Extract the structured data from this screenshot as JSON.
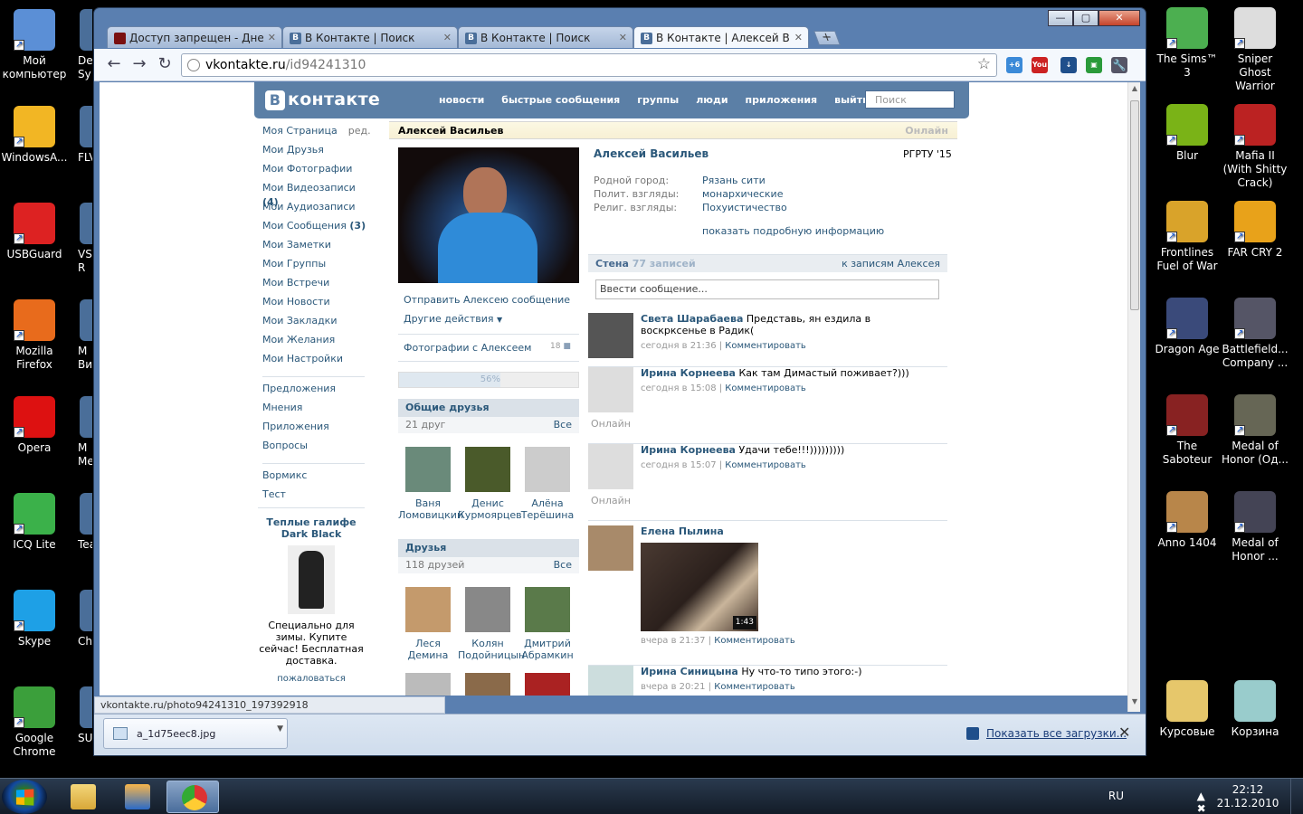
{
  "desktop": {
    "left_icons": [
      {
        "label": "Мой компьютер",
        "color": "#5b8fd6"
      },
      {
        "label": "WindowsA...",
        "color": "#f2b624"
      },
      {
        "label": "USBGuard",
        "color": "#d22"
      },
      {
        "label": "Mozilla Firefox",
        "color": "#e86b1c"
      },
      {
        "label": "Opera",
        "color": "#d11"
      },
      {
        "label": "ICQ Lite",
        "color": "#3bb14a"
      },
      {
        "label": "Skype",
        "color": "#1ea0e6"
      },
      {
        "label": "Google Chrome",
        "color": "#3b9f3b"
      }
    ],
    "partial_icons": [
      "De Sy",
      "FLV",
      "VSO R",
      "M Виде",
      "M Мед",
      "Tea",
      "Che",
      "SU"
    ],
    "right_icons": [
      {
        "label": "The Sims™ 3",
        "color": "#4caf50"
      },
      {
        "label": "Sniper Ghost Warrior",
        "color": "#ddd"
      },
      {
        "label": "Blur",
        "color": "#7ab317"
      },
      {
        "label": "Mafia II (With Shitty Crack)",
        "color": "#b22"
      },
      {
        "label": "Frontlines Fuel of War",
        "color": "#d9a32a"
      },
      {
        "label": "FAR CRY 2",
        "color": "#e8a21a"
      },
      {
        "label": "Dragon Age",
        "color": "#3a4a7a"
      },
      {
        "label": "Battlefield... Company ...",
        "color": "#556"
      },
      {
        "label": "The Saboteur",
        "color": "#822"
      },
      {
        "label": "Medal of Honor (Од...",
        "color": "#665"
      },
      {
        "label": "Anno 1404",
        "color": "#b8864a"
      },
      {
        "label": "Medal of Honor ...",
        "color": "#445"
      },
      {
        "label": "Курсовые",
        "color": "#e6c76b"
      },
      {
        "label": "Корзина",
        "color": "#9cc"
      }
    ]
  },
  "browser": {
    "tabs": [
      {
        "title": "Доступ запрещен - Дне...",
        "icon": "red"
      },
      {
        "title": "В Контакте | Поиск",
        "icon": "vk"
      },
      {
        "title": "В Контакте | Поиск",
        "icon": "vk"
      },
      {
        "title": "В Контакте | Алексей Ва...",
        "icon": "vk",
        "active": true
      }
    ],
    "new_tab": "+",
    "url_domain": "vkontakte.ru",
    "url_path": "/id94241310",
    "status_url": "vkontakte.ru/photo94241310_197392918",
    "download_file": "a_1d75eec8.jpg",
    "show_all_downloads": "Показать все загрузки...",
    "window_controls": {
      "min": "—",
      "max": "▢",
      "close": "✕"
    }
  },
  "vk": {
    "logo_letter": "В",
    "logo_text": "контакте",
    "menu": [
      "новости",
      "быстрые сообщения",
      "группы",
      "люди",
      "приложения",
      "выйти"
    ],
    "search_placeholder": "Поиск",
    "left_nav": [
      {
        "label": "Моя Страница",
        "extra": "ред."
      },
      {
        "label": "Мои Друзья"
      },
      {
        "label": "Мои Фотографии"
      },
      {
        "label": "Мои Видеозаписи",
        "count": "(4)"
      },
      {
        "label": "Мои Аудиозаписи"
      },
      {
        "label": "Мои Сообщения",
        "count": "(3)"
      },
      {
        "label": "Мои Заметки"
      },
      {
        "label": "Мои Группы"
      },
      {
        "label": "Мои Встречи"
      },
      {
        "label": "Мои Новости"
      },
      {
        "label": "Мои Закладки"
      },
      {
        "label": "Мои Желания"
      },
      {
        "label": "Мои Настройки"
      }
    ],
    "left_nav2": [
      "Предложения",
      "Мнения",
      "Приложения",
      "Вопросы"
    ],
    "left_nav3": [
      "Вормикс",
      "Тест"
    ],
    "ad": {
      "title": "Теплые галифе Dark Black",
      "desc": "Специально для зимы. Купите сейчас! Бесплатная доставка.",
      "link": "пожаловаться"
    },
    "profile": {
      "name": "Алексей Васильев",
      "online": "Онлайн",
      "university": "РГРТУ '15",
      "info": [
        {
          "k": "Родной город:",
          "v": "Рязань сити"
        },
        {
          "k": "Полит. взгляды:",
          "v": "монархические"
        },
        {
          "k": "Религ. взгляды:",
          "v": "Похуистичество"
        }
      ],
      "show_more": "показать подробную информацию",
      "send_message": "Отправить Алексею сообщение",
      "other_actions": "Другие действия",
      "photos_with": "Фотографии с Алексеем",
      "photos_count": "18",
      "rating": "56%",
      "rating_value": 0.56
    },
    "common_friends": {
      "title": "Общие друзья",
      "count": "21 друг",
      "all": "Все",
      "items": [
        {
          "name": "Ваня Ломовицкий",
          "color": "#6a8a7a"
        },
        {
          "name": "Денис Курмоярцев",
          "color": "#4a5a2a"
        },
        {
          "name": "Алёна Терёшина",
          "color": "#ccc"
        }
      ]
    },
    "friends": {
      "title": "Друзья",
      "count": "118 друзей",
      "all": "Все",
      "items": [
        {
          "name": "Леся Демина",
          "color": "#c49a6c"
        },
        {
          "name": "Колян Подойницын",
          "color": "#888"
        },
        {
          "name": "Дмитрий Абрамкин",
          "color": "#5a7a4a"
        }
      ],
      "more_colors": [
        "#bbb",
        "#8a6a4a",
        "#aa2222"
      ]
    },
    "wall": {
      "title": "Стена",
      "count": "77 записей",
      "link": "к записям Алексея",
      "input_placeholder": "Ввести сообщение...",
      "comment": "Комментировать",
      "posts": [
        {
          "author": "Света Шарабаева",
          "text": "Представь, ян ездила в воскрксенье в Радик(",
          "time": "сегодня в 21:36",
          "status": "",
          "color": "#555"
        },
        {
          "author": "Ирина Корнеева",
          "text": "Как там Димастый поживает?)))",
          "time": "сегодня в 15:08",
          "status": "Онлайн",
          "color": "#ddd"
        },
        {
          "author": "Ирина Корнеева",
          "text": "Удачи тебе!!!)))))))))",
          "time": "сегодня в 15:07",
          "status": "Онлайн",
          "color": "#ddd"
        },
        {
          "author": "Елена Пылина",
          "text": "",
          "time": "вчера в 21:37",
          "status": "",
          "color": "#a88a6a",
          "video": "1:43"
        },
        {
          "author": "Ирина Синицына",
          "text": "Ну что-то типо этого:-)",
          "time": "вчера в 20:21",
          "status": "",
          "color": "#cdd"
        }
      ]
    }
  },
  "taskbar": {
    "lang": "RU",
    "time": "22:12",
    "date": "21.12.2010"
  }
}
